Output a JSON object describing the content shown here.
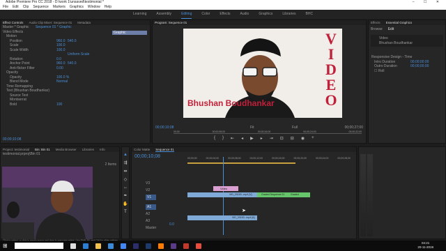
{
  "title": "Adobe Premiere Pro CC 2018 - D:\\work 1\\unsaved\\testimonial *",
  "menu": [
    "File",
    "Edit",
    "Clip",
    "Sequence",
    "Markers",
    "Graphics",
    "Window",
    "Help"
  ],
  "workspaces": [
    "Learning",
    "Assembly",
    "Editing",
    "Color",
    "Effects",
    "Audio",
    "Graphics",
    "Libraries",
    "BHC"
  ],
  "active_workspace": "Editing",
  "source_tabs": [
    "Effect Controls",
    "Audio Clip Mixer: Sequence 01",
    "Metadata"
  ],
  "effect_controls": {
    "header": "Master * Graphic",
    "sequence": "Sequence 01 * Graphic",
    "clip_label": "Graphic",
    "rows": [
      {
        "label": "Video Effects",
        "indent": 0,
        "v1": "",
        "v2": ""
      },
      {
        "label": "Motion",
        "indent": 1,
        "v1": "",
        "v2": ""
      },
      {
        "label": "Position",
        "indent": 2,
        "v1": "960.0",
        "v2": "540.0"
      },
      {
        "label": "Scale",
        "indent": 2,
        "v1": "100.0",
        "v2": ""
      },
      {
        "label": "Scale Width",
        "indent": 2,
        "v1": "100.0",
        "v2": ""
      },
      {
        "label": "",
        "indent": 2,
        "v1": "",
        "v2": "Uniform Scale"
      },
      {
        "label": "Rotation",
        "indent": 2,
        "v1": "0.0",
        "v2": ""
      },
      {
        "label": "Anchor Point",
        "indent": 2,
        "v1": "960.0",
        "v2": "540.0"
      },
      {
        "label": "Anti-flicker Filter",
        "indent": 2,
        "v1": "0.00",
        "v2": ""
      },
      {
        "label": "Opacity",
        "indent": 1,
        "v1": "",
        "v2": ""
      },
      {
        "label": "Opacity",
        "indent": 2,
        "v1": "100.0 %",
        "v2": ""
      },
      {
        "label": "Blend Mode",
        "indent": 2,
        "v1": "Normal",
        "v2": ""
      },
      {
        "label": "Time Remapping",
        "indent": 1,
        "v1": "",
        "v2": ""
      },
      {
        "label": "Text (Bhushan Boudhankar)",
        "indent": 1,
        "v1": "",
        "v2": ""
      },
      {
        "label": "Source Text",
        "indent": 2,
        "v1": "",
        "v2": ""
      },
      {
        "label": "Montserrat",
        "indent": 2,
        "v1": "",
        "v2": ""
      },
      {
        "label": "Bold",
        "indent": 2,
        "v1": "100",
        "v2": ""
      }
    ],
    "timecode": "00;00;10;08"
  },
  "program": {
    "tab": "Program: Sequence 01",
    "overlay_name": "Bhushan Boudhankar",
    "overlay_word": "VIDEO",
    "timecode_left": "00;00;10;08",
    "fit": "Fit",
    "quality": "Full",
    "timecode_right": "00;00;27;00",
    "ruler": [
      "00;00",
      "00;00;08;00",
      "00;00;16;00",
      "00;00;24;00",
      "00;00;32;00"
    ]
  },
  "essential_graphics": {
    "tabs": [
      "Effects",
      "Essential Graphics"
    ],
    "subtabs": [
      "Browse",
      "Edit"
    ],
    "layers": [
      "Video",
      "Bhushan Boudhankar"
    ],
    "section": "Responsive Design - Time",
    "intro_label": "Intro Duration",
    "intro_value": "00;00;00;00",
    "outro_label": "Outro Duration",
    "outro_value": "00;00;00;00",
    "roll": "Roll"
  },
  "project": {
    "tabs": [
      "Project: testimonial",
      "Bin: Bin 01",
      "Media Browser",
      "Libraries",
      "Info"
    ],
    "file": "testimonial.prproj\\Bin 01",
    "count": "2 Items"
  },
  "timeline": {
    "tabs": [
      "Color Matte",
      "Sequence 01"
    ],
    "timecode": "00;00;10;08",
    "ruler": [
      "00;00;00",
      "00;00;04;00",
      "00;00;08;00",
      "00;00;12;00",
      "00;00;16;00",
      "00;00;20;00",
      "00;00;24;00",
      "00;00;28;00"
    ],
    "tracks": [
      "V3",
      "V2",
      "V1",
      "A1",
      "A2",
      "A3",
      "Master"
    ],
    "clips": [
      {
        "track": "V2",
        "label": "Video",
        "color": "#d89fd0"
      },
      {
        "track": "V1",
        "label": "VID_20190...mp4 [V]",
        "color": "#7fa9d6"
      },
      {
        "track": "V1",
        "label": "Graded Sequence 01",
        "color": "#66c46a"
      },
      {
        "track": "V1",
        "label": "Graded Sequence 01",
        "color": "#66c46a"
      },
      {
        "track": "A1",
        "label": "VID_20190...mp4 [A]",
        "color": "#7fa9d6"
      }
    ],
    "master_value": "0.0"
  },
  "status": "Click to select, or click in empty space and drag to marquee select. Use Shift, Alt, and Ctrl for other options.",
  "clock": {
    "time": "04:21",
    "date": "20-11-2019"
  },
  "colors": {
    "accent": "#4a8fd9",
    "name_text": "#c0203a",
    "bg": "#1d1d1d"
  }
}
